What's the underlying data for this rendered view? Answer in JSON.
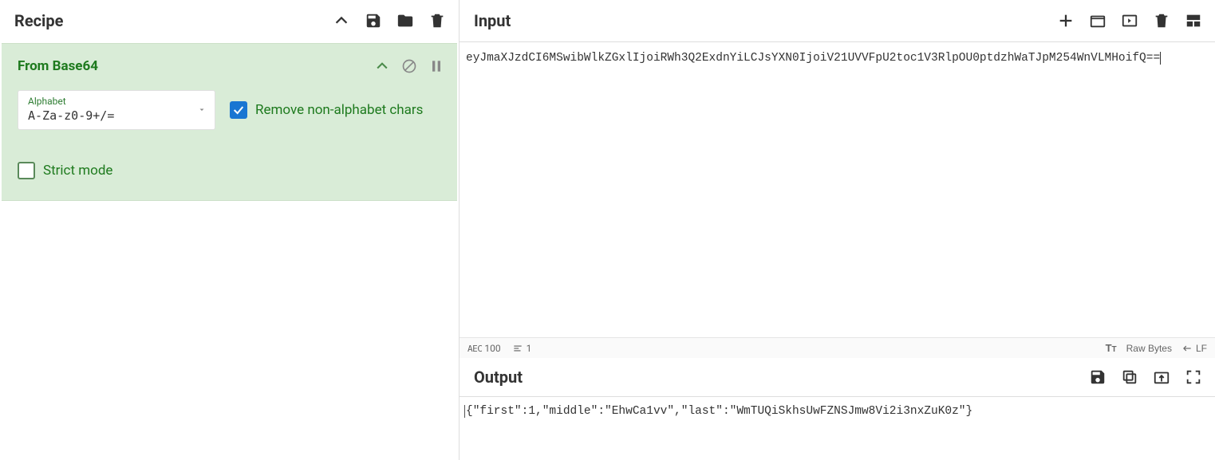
{
  "recipe": {
    "title": "Recipe",
    "operations": [
      {
        "name": "From Base64",
        "alphabet_label": "Alphabet",
        "alphabet_value": "A-Za-z0-9+/=",
        "remove_non_alpha_label": "Remove non-alphabet chars",
        "remove_non_alpha_checked": true,
        "strict_label": "Strict mode",
        "strict_checked": false
      }
    ]
  },
  "input": {
    "title": "Input",
    "text": "eyJmaXJzdCI6MSwibWlkZGxlIjoiRWh3Q2ExdnYiLCJsYXN0IjoiV21UVVFpU2toc1V3RlpOU0ptdzhWaTJpM254WnVLMHoifQ=="
  },
  "status": {
    "aec_label": "AEC",
    "aec_value": "100",
    "lines_value": "1",
    "tr_label": "Tr",
    "bytes_label": "Raw Bytes",
    "eol_label": "LF"
  },
  "output": {
    "title": "Output",
    "text": "{\"first\":1,\"middle\":\"EhwCa1vv\",\"last\":\"WmTUQiSkhsUwFZNSJmw8Vi2i3nxZuK0z\"}"
  }
}
